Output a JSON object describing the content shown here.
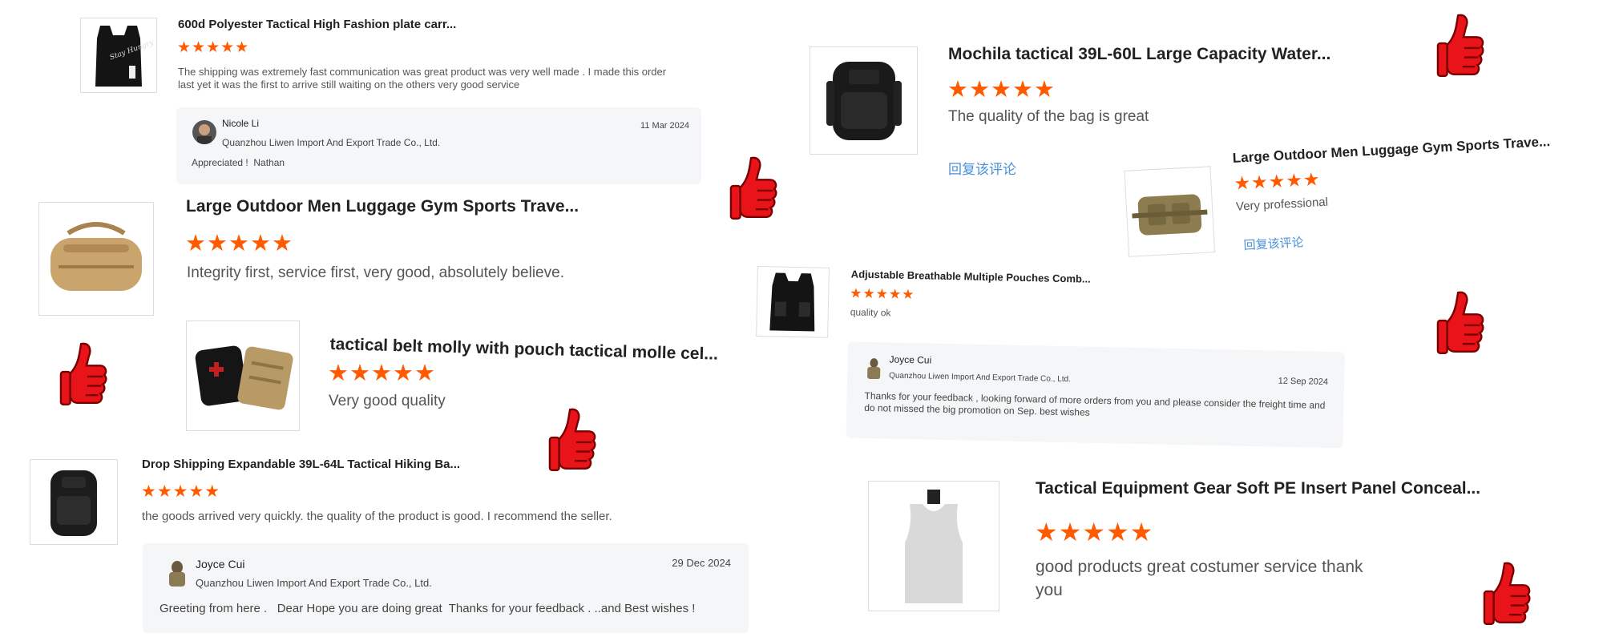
{
  "reviews": [
    {
      "title": "600d Polyester Tactical High Fashion plate carr...",
      "stars": "★★★★★",
      "text": "The shipping was extremely fast communication was great product was very well made . I made this order last yet it was the first to arrive still waiting on the others very good service",
      "thumb_icon": "black-vest-icon",
      "vest_print": "Stay Hungry",
      "reply": {
        "name": "Nicole Li",
        "company": "Quanzhou Liwen Import And Export Trade Co., Ltd.",
        "date": "11 Mar 2024",
        "message": "Appreciated !  Nathan"
      }
    },
    {
      "title": "Large Outdoor Men Luggage Gym Sports Trave...",
      "stars": "★★★★★",
      "text": "Integrity first, service first, very good, absolutely believe.",
      "thumb_icon": "tan-duffel-bag-icon"
    },
    {
      "title": "tactical belt molly with pouch tactical molle cel...",
      "stars": "★★★★★",
      "text": "Very good quality",
      "thumb_icon": "medical-pouch-icon"
    },
    {
      "title": "Drop Shipping Expandable 39L-64L Tactical Hiking Ba...",
      "stars": "★★★★★",
      "text": "the goods arrived very quickly. the quality of the product is good. I recommend the seller.",
      "thumb_icon": "black-backpack-icon",
      "reply": {
        "name": "Joyce Cui",
        "company": "Quanzhou Liwen Import And Export Trade Co., Ltd.",
        "date": "29 Dec 2024",
        "message": "Greeting from here .   Dear Hope you are doing great  Thanks for your feedback . ..and Best wishes !"
      }
    },
    {
      "title": "Mochila tactical 39L-60L Large Capacity Water...",
      "stars": "★★★★★",
      "text": "The quality of the bag is great",
      "link": "回复该评论",
      "thumb_icon": "black-backpack-icon"
    },
    {
      "title": "Large Outdoor Men Luggage Gym Sports Trave...",
      "stars": "★★★★★",
      "text": "Very professional",
      "link": "回复该评论",
      "thumb_icon": "tan-waist-bag-icon"
    },
    {
      "title": "Adjustable Breathable Multiple Pouches Comb...",
      "stars": "★★★★★",
      "text": "quality ok",
      "thumb_icon": "tactical-vest-icon",
      "reply": {
        "name": "Joyce Cui",
        "company": "Quanzhou Liwen Import And Export Trade Co., Ltd.",
        "date": "12 Sep 2024",
        "message": "Thanks for your feedback , looking forward of more orders from you and please consider the freight time and do not missed the big promotion on Sep. best wishes"
      }
    },
    {
      "title": "Tactical Equipment Gear Soft PE Insert Panel Conceal...",
      "stars": "★★★★★",
      "text": "good products great costumer service thank you",
      "thumb_icon": "white-tank-vest-icon"
    }
  ],
  "colors": {
    "star": "#ff5a00",
    "thumbs_up": "#e8141a",
    "link": "#4a90d9",
    "reply_bg": "#f5f6f7"
  },
  "decor_icon": "thumbs-up-icon"
}
